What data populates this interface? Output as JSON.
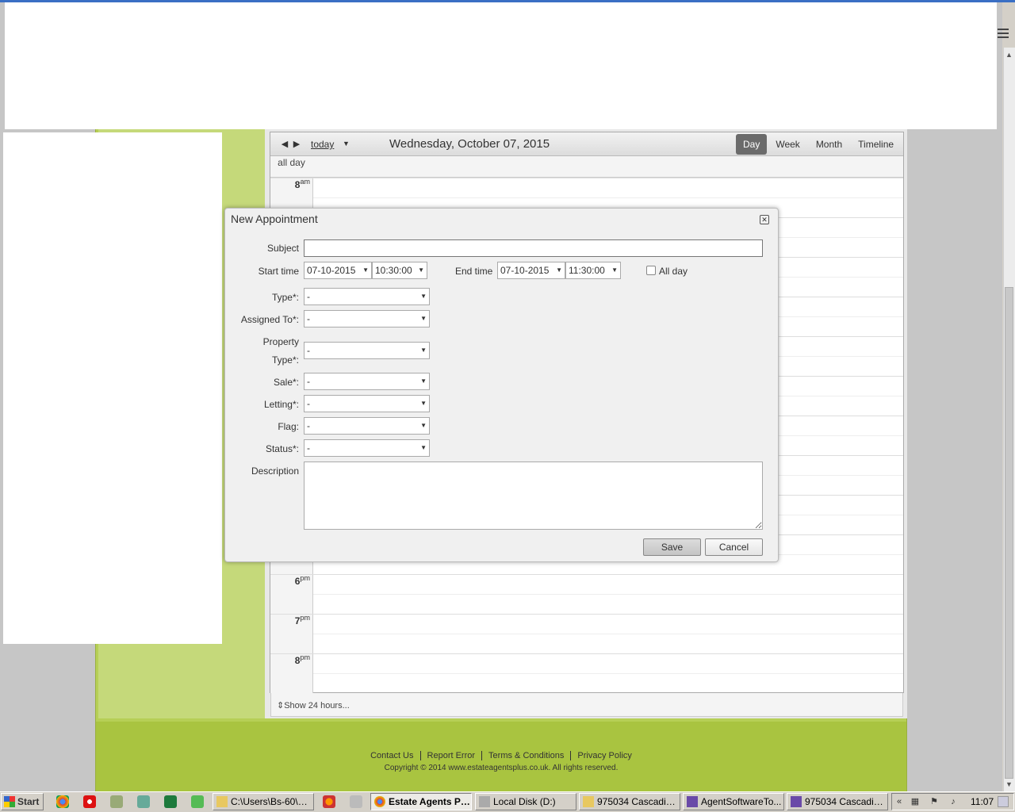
{
  "calendar": {
    "nav_prev": "◀",
    "nav_next": "▶",
    "today_label": "today",
    "date_title": "Wednesday, October 07, 2015",
    "views": [
      "Day",
      "Week",
      "Month",
      "Timeline"
    ],
    "active_view": "Day",
    "allday_label": "all day",
    "hours": [
      {
        "h": "8",
        "ap": "am"
      },
      {
        "h": "6",
        "ap": "pm"
      },
      {
        "h": "7",
        "ap": "pm"
      },
      {
        "h": "8",
        "ap": "pm"
      }
    ],
    "show24_label": "Show 24 hours..."
  },
  "dialog": {
    "title": "New Appointment",
    "subject_label": "Subject",
    "subject_value": "",
    "start_label": "Start time",
    "start_date": "07-10-2015",
    "start_time": "10:30:00",
    "end_label": "End time",
    "end_date": "07-10-2015",
    "end_time": "11:30:00",
    "allday_label": "All day",
    "fields": [
      {
        "label": "Type*:",
        "value": "-"
      },
      {
        "label": "Assigned To*:",
        "value": "-"
      },
      {
        "label": "Property",
        "label2": "Type*:",
        "value": "-"
      },
      {
        "label": "Sale*:",
        "value": "-"
      },
      {
        "label": "Letting*:",
        "value": "-"
      },
      {
        "label": "Flag:",
        "value": "-"
      },
      {
        "label": "Status*:",
        "value": "-"
      }
    ],
    "description_label": "Description",
    "save_label": "Save",
    "cancel_label": "Cancel"
  },
  "footer": {
    "links": [
      "Contact Us",
      "Report Error",
      "Terms & Conditions",
      "Privacy Policy"
    ],
    "copyright": "Copyright © 2014 www.estateagentsplus.co.uk. All rights reserved."
  },
  "taskbar": {
    "start_label": "Start",
    "tasks": [
      {
        "label": "C:\\Users\\Bs-60\\De...",
        "icon": "folder-icon"
      },
      {
        "label": "Estate Agents Pl...",
        "icon": "chrome-icon",
        "active": true
      },
      {
        "label": "Local Disk (D:)",
        "icon": "drive-icon"
      },
      {
        "label": "975034 Cascading...",
        "icon": "folder-icon"
      },
      {
        "label": "AgentSoftwareTo...",
        "icon": "vs-icon"
      },
      {
        "label": "975034 Cascading...",
        "icon": "vs-icon"
      }
    ],
    "clock": "11:07"
  },
  "colors": {
    "site_green": "#b6cf56",
    "panel_green": "#c5d97a",
    "active_view_bg": "#6b6b6b"
  }
}
